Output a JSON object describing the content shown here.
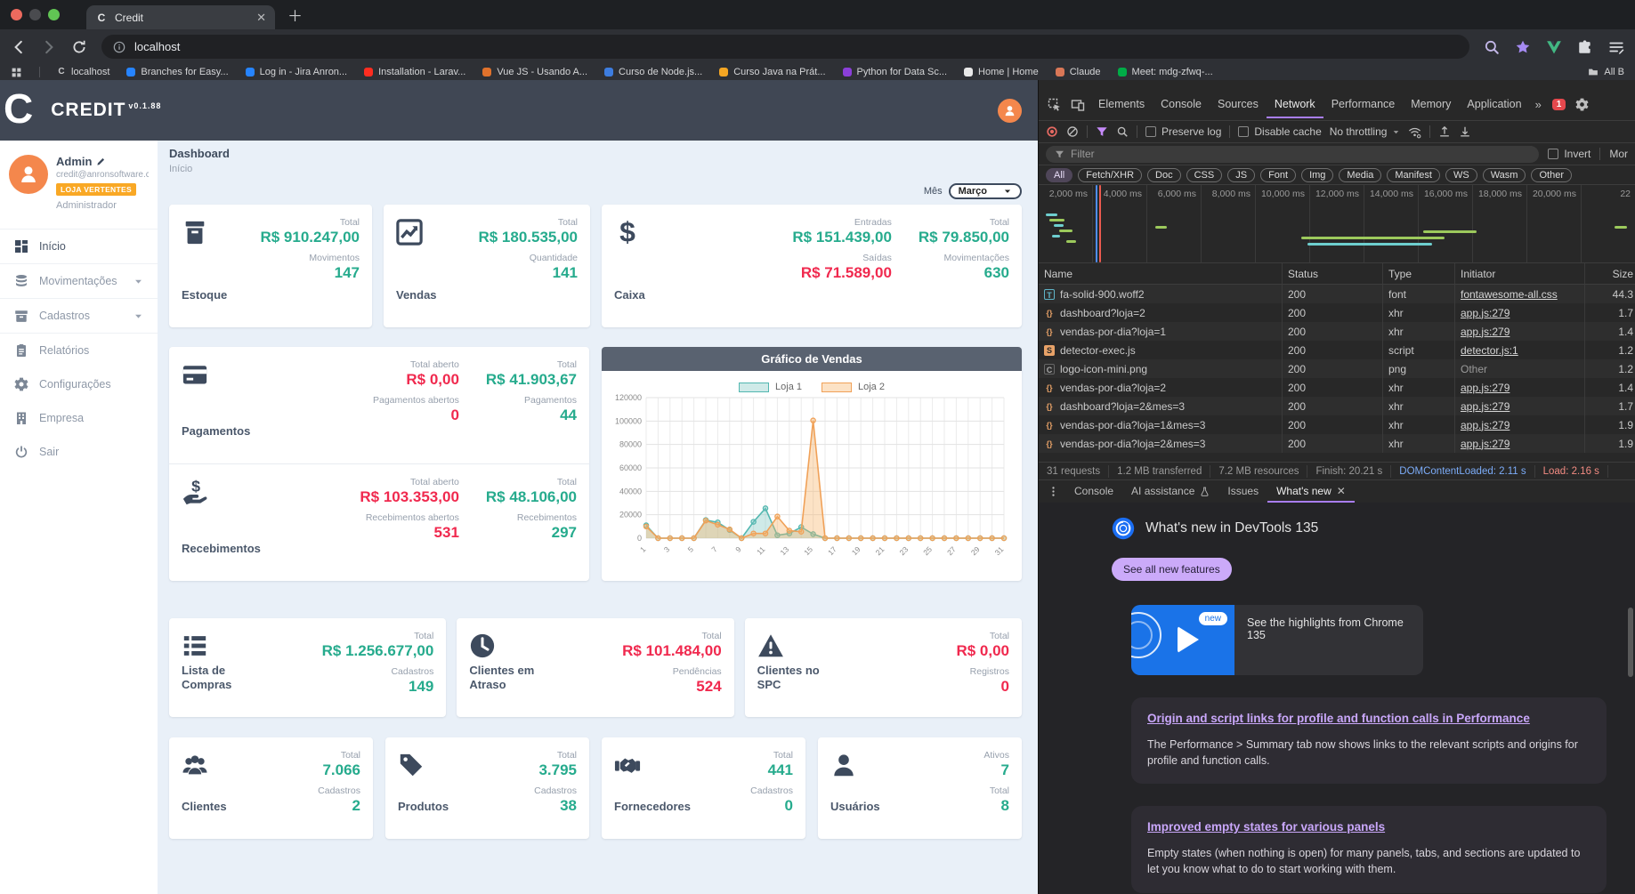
{
  "browser": {
    "tab_title": "Credit",
    "tab_favicon": "C",
    "url": "localhost",
    "all_bookmarks": "All B",
    "bookmarks": [
      {
        "label": "localhost",
        "color": "#c9cacc",
        "glyph": "C"
      },
      {
        "label": "Branches for Easy...",
        "color": "#2684ff"
      },
      {
        "label": "Log in - Jira Anron...",
        "color": "#2684ff"
      },
      {
        "label": "Installation - Larav...",
        "color": "#ff2d20"
      },
      {
        "label": "Vue JS - Usando A...",
        "color": "#e0722c"
      },
      {
        "label": "Curso de Node.js...",
        "color": "#3d7de0"
      },
      {
        "label": "Curso Java na Prát...",
        "color": "#f5a623"
      },
      {
        "label": "Python for Data Sc...",
        "color": "#8b3fd9"
      },
      {
        "label": "Home | Home",
        "color": "#e8e8e8"
      },
      {
        "label": "Claude",
        "color": "#d97757"
      },
      {
        "label": "Meet: mdg-zfwq-...",
        "color": "#00ac47"
      }
    ]
  },
  "app": {
    "brand": {
      "initial": "C",
      "name": "CREDIT",
      "version": "v0.1.88"
    },
    "user": {
      "name": "Admin",
      "email": "credit@anronsoftware.co...",
      "badge": "LOJA VERTENTES",
      "role": "Administrador"
    },
    "sidebar": [
      {
        "label": "Início",
        "icon": "grid",
        "active": true,
        "group": true
      },
      {
        "label": "Movimentações",
        "icon": "db",
        "chevron": true,
        "group": true
      },
      {
        "label": "Cadastros",
        "icon": "archive",
        "chevron": true,
        "group": true
      },
      {
        "label": "Relatórios",
        "icon": "report"
      },
      {
        "label": "Configurações",
        "icon": "gear"
      },
      {
        "label": "Empresa",
        "icon": "building"
      },
      {
        "label": "Sair",
        "icon": "power"
      }
    ],
    "page": {
      "title": "Dashboard",
      "subtitle": "Início"
    },
    "month": {
      "label": "Mês",
      "value": "Março"
    },
    "cards_row1": [
      {
        "title": "Estoque",
        "icon": "box",
        "cols": [
          [
            {
              "label": "Total",
              "value": "R$ 910.247,00",
              "c": "g"
            },
            {
              "label": "Movimentos",
              "value": "147",
              "c": "g"
            }
          ]
        ]
      },
      {
        "title": "Vendas",
        "icon": "chart",
        "cols": [
          [
            {
              "label": "Total",
              "value": "R$ 180.535,00",
              "c": "g"
            },
            {
              "label": "Quantidade",
              "value": "141",
              "c": "g"
            }
          ]
        ]
      },
      {
        "title": "Caixa",
        "icon": "dollar",
        "cols": [
          [
            {
              "label": "Entradas",
              "value": "R$ 151.439,00",
              "c": "g"
            },
            {
              "label": "Saídas",
              "value": "R$ 71.589,00",
              "c": "r"
            }
          ],
          [
            {
              "label": "Total",
              "value": "R$ 79.850,00",
              "c": "g"
            },
            {
              "label": "Movimentações",
              "value": "630",
              "c": "g"
            }
          ]
        ]
      }
    ],
    "finance_rows": [
      {
        "title": "Pagamentos",
        "icon": "card",
        "cols": [
          [
            {
              "label": "Total aberto",
              "value": "R$ 0,00",
              "c": "r"
            },
            {
              "label": "Pagamentos abertos",
              "value": "0",
              "c": "r"
            }
          ],
          [
            {
              "label": "Total",
              "value": "R$ 41.903,67",
              "c": "g"
            },
            {
              "label": "Pagamentos",
              "value": "44",
              "c": "g"
            }
          ]
        ]
      },
      {
        "title": "Recebimentos",
        "icon": "handdollar",
        "cols": [
          [
            {
              "label": "Total aberto",
              "value": "R$ 103.353,00",
              "c": "r"
            },
            {
              "label": "Recebimentos abertos",
              "value": "531",
              "c": "r"
            }
          ],
          [
            {
              "label": "Total",
              "value": "R$ 48.106,00",
              "c": "g"
            },
            {
              "label": "Recebimentos",
              "value": "297",
              "c": "g"
            }
          ]
        ]
      }
    ],
    "cards_row3": [
      {
        "title": "Lista de Compras",
        "icon": "list",
        "cols": [
          [
            {
              "label": "Total",
              "value": "R$ 1.256.677,00",
              "c": "g"
            },
            {
              "label": "Cadastros",
              "value": "149",
              "c": "g"
            }
          ]
        ]
      },
      {
        "title": "Clientes em Atraso",
        "icon": "clock",
        "cols": [
          [
            {
              "label": "Total",
              "value": "R$ 101.484,00",
              "c": "r"
            },
            {
              "label": "Pendências",
              "value": "524",
              "c": "r"
            }
          ]
        ]
      },
      {
        "title": "Clientes no SPC",
        "icon": "warning",
        "cols": [
          [
            {
              "label": "Total",
              "value": "R$ 0,00",
              "c": "r"
            },
            {
              "label": "Registros",
              "value": "0",
              "c": "r"
            }
          ]
        ]
      }
    ],
    "cards_row4": [
      {
        "title": "Clientes",
        "icon": "users",
        "cols": [
          [
            {
              "label": "Total",
              "value": "7.066",
              "c": "g"
            },
            {
              "label": "Cadastros",
              "value": "2",
              "c": "g"
            }
          ]
        ]
      },
      {
        "title": "Produtos",
        "icon": "tag",
        "cols": [
          [
            {
              "label": "Total",
              "value": "3.795",
              "c": "g"
            },
            {
              "label": "Cadastros",
              "value": "38",
              "c": "g"
            }
          ]
        ]
      },
      {
        "title": "Fornecedores",
        "icon": "handshake",
        "cols": [
          [
            {
              "label": "Total",
              "value": "441",
              "c": "g"
            },
            {
              "label": "Cadastros",
              "value": "0",
              "c": "g"
            }
          ]
        ]
      },
      {
        "title": "Usuários",
        "icon": "user",
        "cols": [
          [
            {
              "label": "Ativos",
              "value": "7",
              "c": "g"
            },
            {
              "label": "Total",
              "value": "8",
              "c": "g"
            }
          ]
        ]
      }
    ]
  },
  "chart_data": {
    "type": "line",
    "title": "Gráfico de Vendas",
    "x": [
      1,
      2,
      3,
      4,
      5,
      6,
      7,
      8,
      9,
      10,
      11,
      12,
      13,
      14,
      15,
      16,
      17,
      18,
      19,
      20,
      21,
      22,
      23,
      24,
      25,
      26,
      27,
      28,
      29,
      30,
      31
    ],
    "series": [
      {
        "name": "Loja 1",
        "color": "#52b7b0",
        "fill": "rgba(130,200,195,0.38)",
        "values": [
          11000,
          0,
          0,
          0,
          0,
          15500,
          13500,
          7000,
          0,
          14000,
          25500,
          2500,
          4000,
          9500,
          3500,
          0,
          0,
          0,
          0,
          0,
          0,
          0,
          0,
          0,
          0,
          0,
          0,
          0,
          0,
          0,
          0
        ]
      },
      {
        "name": "Loja 2",
        "color": "#f0a158",
        "fill": "rgba(247,178,103,0.38)",
        "values": [
          10000,
          0,
          0,
          0,
          0,
          15000,
          11500,
          7500,
          0,
          4000,
          4000,
          18500,
          6500,
          5500,
          100500,
          0,
          0,
          0,
          0,
          0,
          0,
          0,
          0,
          0,
          0,
          0,
          0,
          0,
          0,
          0,
          0
        ]
      }
    ],
    "ylim": [
      0,
      120000
    ],
    "ytick_step": 20000,
    "grid": true,
    "legend_position": "top"
  },
  "devtools": {
    "tabs": [
      "Elements",
      "Console",
      "Sources",
      "Network",
      "Performance",
      "Memory",
      "Application"
    ],
    "active_tab": "Network",
    "error_badge": "1",
    "toolbar": {
      "preserve_log": "Preserve log",
      "disable_cache": "Disable cache",
      "throttling": "No throttling"
    },
    "filter": {
      "placeholder": "Filter",
      "invert": "Invert",
      "more": "Mor"
    },
    "chips": [
      "All",
      "Fetch/XHR",
      "Doc",
      "CSS",
      "JS",
      "Font",
      "Img",
      "Media",
      "Manifest",
      "WS",
      "Wasm",
      "Other"
    ],
    "active_chip": "All",
    "timeline_ticks": [
      "2,000 ms",
      "4,000 ms",
      "6,000 ms",
      "8,000 ms",
      "10,000 ms",
      "12,000 ms",
      "14,000 ms",
      "16,000 ms",
      "18,000 ms",
      "20,000 ms",
      "22"
    ],
    "waterfall_bars": [
      {
        "x": 1.2,
        "y": 12,
        "w": 2.0,
        "color": "teal"
      },
      {
        "x": 1.8,
        "y": 18,
        "w": 2.6,
        "color": "green"
      },
      {
        "x": 2.6,
        "y": 24,
        "w": 1.6,
        "color": "teal"
      },
      {
        "x": 3.4,
        "y": 30,
        "w": 2.2,
        "color": "green"
      },
      {
        "x": 2.2,
        "y": 36,
        "w": 1.4,
        "color": "teal"
      },
      {
        "x": 4.6,
        "y": 42,
        "w": 1.6,
        "color": "green"
      },
      {
        "x": 9.6,
        "y": 0,
        "w": 0.3,
        "color": "blue",
        "full": true
      },
      {
        "x": 10.1,
        "y": 0,
        "w": 0.3,
        "color": "red",
        "full": true
      },
      {
        "x": 19.5,
        "y": 26,
        "w": 2.0,
        "color": "green"
      },
      {
        "x": 44.0,
        "y": 38,
        "w": 24.0,
        "color": "green"
      },
      {
        "x": 45.0,
        "y": 45,
        "w": 21.0,
        "color": "teal"
      },
      {
        "x": 64.5,
        "y": 31,
        "w": 9.0,
        "color": "green"
      },
      {
        "x": 96.5,
        "y": 26,
        "w": 2.2,
        "color": "green"
      }
    ],
    "columns": [
      "Name",
      "Status",
      "Type",
      "Initiator",
      "Size"
    ],
    "requests": [
      {
        "name": "fa-solid-900.woff2",
        "kind": "font",
        "status": "200",
        "type": "font",
        "initiator": "fontawesome-all.css",
        "link": true,
        "size": "44.3"
      },
      {
        "name": "dashboard?loja=2",
        "kind": "xhr",
        "status": "200",
        "type": "xhr",
        "initiator": "app.js:279",
        "link": true,
        "size": "1.7"
      },
      {
        "name": "vendas-por-dia?loja=1",
        "kind": "xhr",
        "status": "200",
        "type": "xhr",
        "initiator": "app.js:279",
        "link": true,
        "size": "1.4"
      },
      {
        "name": "detector-exec.js",
        "kind": "script",
        "status": "200",
        "type": "script",
        "initiator": "detector.js:1",
        "link": true,
        "size": "1.2"
      },
      {
        "name": "logo-icon-mini.png",
        "kind": "img",
        "status": "200",
        "type": "png",
        "initiator": "Other",
        "link": false,
        "size": "1.2"
      },
      {
        "name": "vendas-por-dia?loja=2",
        "kind": "xhr",
        "status": "200",
        "type": "xhr",
        "initiator": "app.js:279",
        "link": true,
        "size": "1.4"
      },
      {
        "name": "dashboard?loja=2&mes=3",
        "kind": "xhr",
        "status": "200",
        "type": "xhr",
        "initiator": "app.js:279",
        "link": true,
        "size": "1.7"
      },
      {
        "name": "vendas-por-dia?loja=1&mes=3",
        "kind": "xhr",
        "status": "200",
        "type": "xhr",
        "initiator": "app.js:279",
        "link": true,
        "size": "1.9"
      },
      {
        "name": "vendas-por-dia?loja=2&mes=3",
        "kind": "xhr",
        "status": "200",
        "type": "xhr",
        "initiator": "app.js:279",
        "link": true,
        "size": "1.9"
      }
    ],
    "summary": [
      "31 requests",
      "1.2 MB transferred",
      "7.2 MB resources",
      "Finish: 20.21 s",
      "DOMContentLoaded: 2.11 s",
      "Load: 2.16 s"
    ],
    "drawer_tabs": [
      "Console",
      "AI assistance",
      "Issues",
      "What's new"
    ],
    "active_drawer_tab": "What's new",
    "whatsnew": {
      "title": "What's new in DevTools 135",
      "button": "See all new features",
      "highlight_badge": "new",
      "highlight_text": "See the highlights from Chrome 135",
      "sections": [
        {
          "title": "Origin and script links for profile and function calls in Performance",
          "body": "The Performance > Summary tab now shows links to the relevant scripts and origins for profile and function calls."
        },
        {
          "title": "Improved empty states for various panels",
          "body": "Empty states (when nothing is open) for many panels, tabs, and sections are updated to let you know what to do to start working with them."
        }
      ]
    },
    "accent": "#a97ef2"
  }
}
